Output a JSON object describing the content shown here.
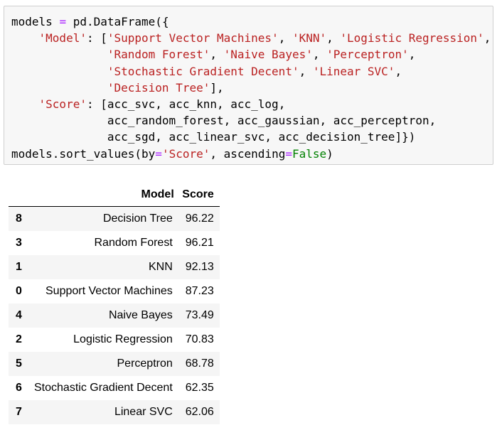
{
  "code_lines": [
    [
      "models ",
      {
        "o": "="
      },
      " pd.DataFrame({"
    ],
    [
      "    ",
      {
        "s": "'Model'"
      },
      ": [",
      {
        "s": "'Support Vector Machines'"
      },
      ", ",
      {
        "s": "'KNN'"
      },
      ", ",
      {
        "s": "'Logistic Regression'"
      },
      ","
    ],
    [
      "              ",
      {
        "s": "'Random Forest'"
      },
      ", ",
      {
        "s": "'Naive Bayes'"
      },
      ", ",
      {
        "s": "'Perceptron'"
      },
      ","
    ],
    [
      "              ",
      {
        "s": "'Stochastic Gradient Decent'"
      },
      ", ",
      {
        "s": "'Linear SVC'"
      },
      ","
    ],
    [
      "              ",
      {
        "s": "'Decision Tree'"
      },
      "],"
    ],
    [
      "    ",
      {
        "s": "'Score'"
      },
      ": [acc_svc, acc_knn, acc_log,"
    ],
    [
      "              acc_random_forest, acc_gaussian, acc_perceptron,"
    ],
    [
      "              acc_sgd, acc_linear_svc, acc_decision_tree]})"
    ],
    [
      "models.sort_values(by",
      {
        "o": "="
      },
      {
        "s": "'Score'"
      },
      ", ascending",
      {
        "o": "="
      },
      {
        "k": "False"
      },
      ")"
    ]
  ],
  "table": {
    "columns": [
      "Model",
      "Score"
    ],
    "rows": [
      {
        "index": "8",
        "model": "Decision Tree",
        "score": "96.22"
      },
      {
        "index": "3",
        "model": "Random Forest",
        "score": "96.21"
      },
      {
        "index": "1",
        "model": "KNN",
        "score": "92.13"
      },
      {
        "index": "0",
        "model": "Support Vector Machines",
        "score": "87.23"
      },
      {
        "index": "4",
        "model": "Naive Bayes",
        "score": "73.49"
      },
      {
        "index": "2",
        "model": "Logistic Regression",
        "score": "70.83"
      },
      {
        "index": "5",
        "model": "Perceptron",
        "score": "68.78"
      },
      {
        "index": "6",
        "model": "Stochastic Gradient Decent",
        "score": "62.35"
      },
      {
        "index": "7",
        "model": "Linear SVC",
        "score": "62.06"
      }
    ]
  }
}
